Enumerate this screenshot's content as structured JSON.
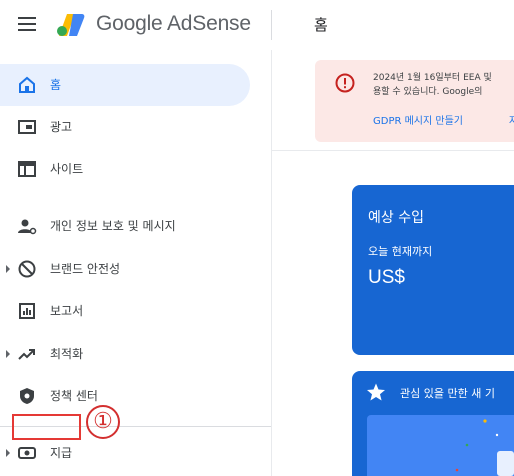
{
  "header": {
    "brand_label": "Google AdSense",
    "page_title": "홈"
  },
  "sidebar": {
    "items": [
      {
        "label": "홈",
        "icon": "home-icon",
        "active": true
      },
      {
        "label": "광고",
        "icon": "ads-icon"
      },
      {
        "label": "사이트",
        "icon": "sites-icon"
      },
      {
        "label": "개인 정보 보호 및 메시지",
        "icon": "privacy-messaging-icon"
      },
      {
        "label": "브랜드 안전성",
        "icon": "block-icon",
        "expandable": true
      },
      {
        "label": "보고서",
        "icon": "reports-icon"
      },
      {
        "label": "최적화",
        "icon": "trending-icon",
        "expandable": true
      },
      {
        "label": "정책 센터",
        "icon": "shield-icon"
      },
      {
        "label": "지급",
        "icon": "payments-icon",
        "expandable": true
      }
    ]
  },
  "annotation": {
    "step_marker": "①",
    "color": "#e53935"
  },
  "alert": {
    "line1": "2024년 1월 16일부터 EEA 및",
    "line2": "용할 수 있습니다. Google의",
    "link_primary": "GDPR 메시지 만들기",
    "link_secondary": "자"
  },
  "earnings_card": {
    "title": "예상 수입",
    "subtitle": "오늘 현재까지",
    "amount": "US$"
  },
  "recommendations_card": {
    "title": "관심 있을 만한 새 기"
  },
  "colors": {
    "accent": "#1a73e8",
    "card_blue": "#1766d2",
    "alert_bg": "#fce8e6",
    "alert_icon": "#c5221f",
    "active_nav_bg": "#e8f0fe"
  }
}
